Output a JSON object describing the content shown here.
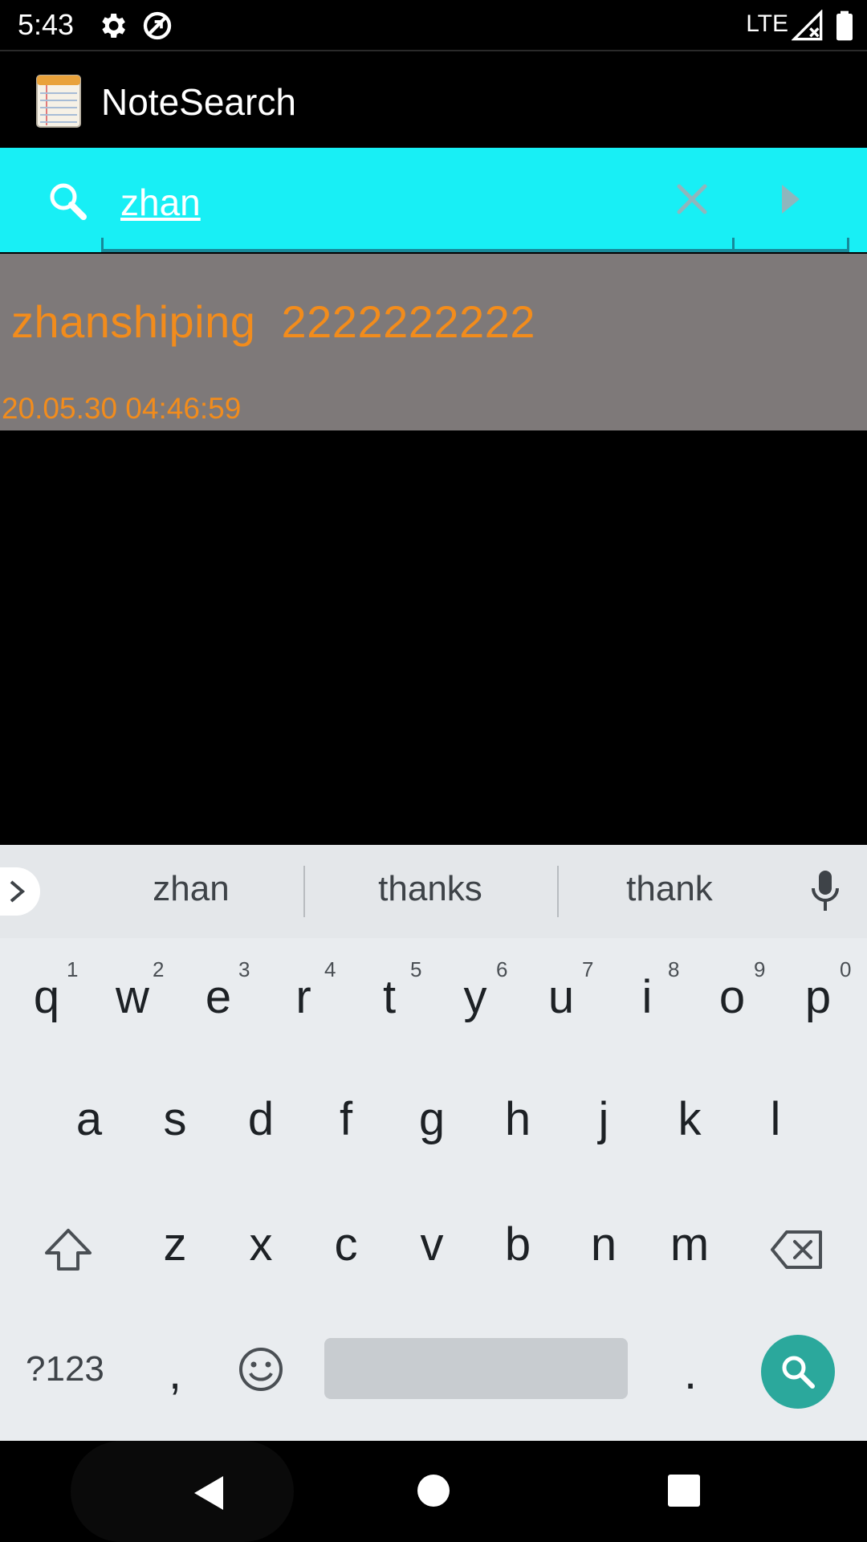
{
  "status_bar": {
    "time": "5:43",
    "network": "LTE",
    "icons": [
      "settings-icon",
      "data-saver-icon",
      "signal-icon",
      "battery-icon"
    ]
  },
  "app_bar": {
    "title": "NoteSearch",
    "logo_icon": "notepad-icon"
  },
  "search": {
    "value": "zhan",
    "accent_color": "#18eff5",
    "icons": [
      "search-icon",
      "clear-icon",
      "go-arrow-icon"
    ]
  },
  "results": [
    {
      "title": "zhanshiping  2222222222",
      "date": "20.05.30 04:46:59"
    }
  ],
  "colors": {
    "result_bg": "#7e7979",
    "result_text": "#f28c1c",
    "search_bg": "#18eff5",
    "enter_key": "#2ba89c"
  },
  "keyboard": {
    "suggestions": [
      "zhan",
      "thanks",
      "thank"
    ],
    "row1": [
      "q",
      "w",
      "e",
      "r",
      "t",
      "y",
      "u",
      "i",
      "o",
      "p"
    ],
    "row1_hints": [
      "1",
      "2",
      "3",
      "4",
      "5",
      "6",
      "7",
      "8",
      "9",
      "0"
    ],
    "row2": [
      "a",
      "s",
      "d",
      "f",
      "g",
      "h",
      "j",
      "k",
      "l"
    ],
    "row3": [
      "z",
      "x",
      "c",
      "v",
      "b",
      "n",
      "m"
    ],
    "symbols_label": "?123",
    "comma": ",",
    "period": "."
  },
  "nav_bar": {
    "icons": [
      "back-icon",
      "home-icon",
      "recents-icon"
    ]
  }
}
